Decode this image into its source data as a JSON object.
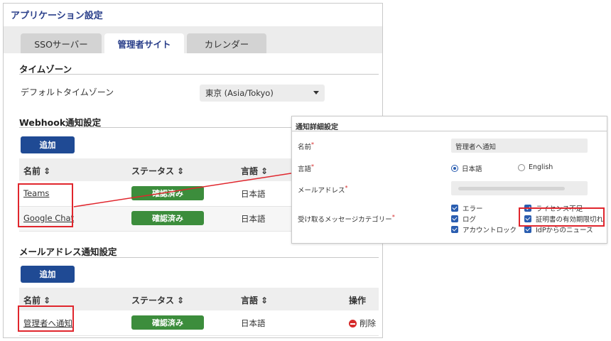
{
  "app_title": "アプリケーション設定",
  "tabs": [
    {
      "label": "SSOサーバー"
    },
    {
      "label": "管理者サイト"
    },
    {
      "label": "カレンダー"
    }
  ],
  "timezone": {
    "title": "タイムゾーン",
    "label": "デフォルトタイムゾーン",
    "value": "東京 (Asia/Tokyo)"
  },
  "webhook": {
    "title": "Webhook通知設定",
    "add_label": "追加",
    "columns": {
      "name": "名前 ⇕",
      "status": "ステータス ⇕",
      "language": "言語 ⇕"
    },
    "rows": [
      {
        "name": "Teams",
        "status": "確認済み",
        "language": "日本語"
      },
      {
        "name": "Google Chat",
        "status": "確認済み",
        "language": "日本語"
      }
    ]
  },
  "email": {
    "title": "メールアドレス通知設定",
    "add_label": "追加",
    "columns": {
      "name": "名前 ⇕",
      "status": "ステータス ⇕",
      "language": "言語 ⇕",
      "action": "操作"
    },
    "rows": [
      {
        "name": "管理者へ通知",
        "status": "確認済み",
        "language": "日本語",
        "action": "削除"
      }
    ]
  },
  "detail": {
    "title": "通知詳細設定",
    "name_label": "名前",
    "name_value": "管理者へ通知",
    "lang_label": "言語",
    "lang_options": [
      "日本語",
      "English"
    ],
    "lang_selected": "日本語",
    "email_label": "メールアドレス",
    "categories_label": "受け取るメッセージカテゴリー",
    "categories": [
      "エラー",
      "ログ",
      "アカウントロック",
      "ライセンス不足",
      "証明書の有効期限切れ",
      "IdPからのニュース"
    ]
  },
  "colors": {
    "accent": "#1f4a94",
    "verified": "#3c8d3c",
    "highlight": "#e0262d",
    "title": "#2a3f8a"
  }
}
